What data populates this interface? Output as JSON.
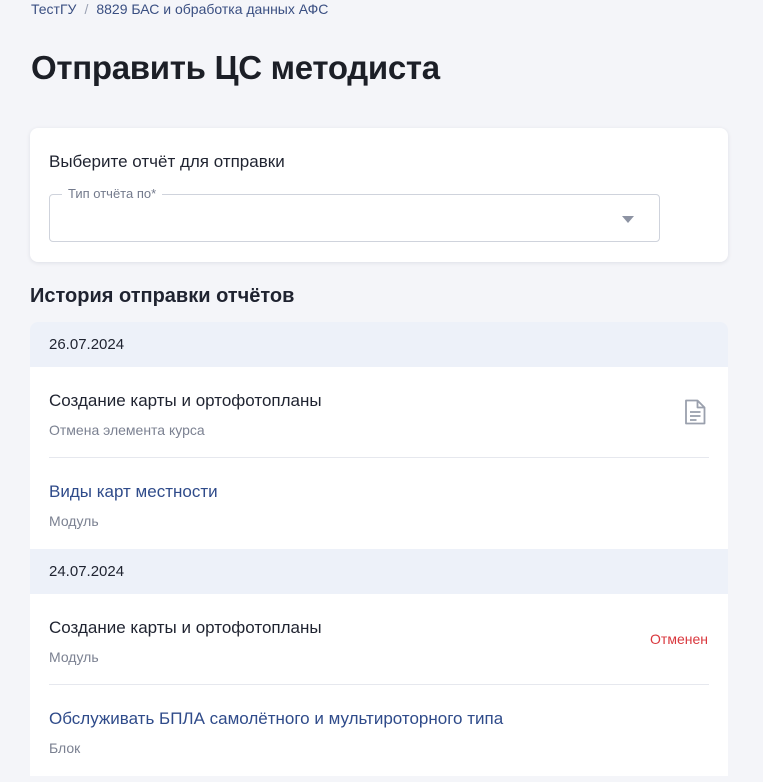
{
  "breadcrumb": {
    "items": [
      "ТестГУ",
      "8829 БАС и обработка данных АФС"
    ],
    "separator": "/"
  },
  "page_title": "Отправить ЦС методиста",
  "report_card": {
    "title": "Выберите отчёт для отправки",
    "select": {
      "label": "Тип отчёта по*",
      "value": ""
    }
  },
  "history": {
    "title": "История отправки отчётов",
    "groups": [
      {
        "date": "26.07.2024",
        "items": [
          {
            "title": "Создание карты и ортофотопланы",
            "subtitle": "Отмена элемента курса",
            "action": "document-icon"
          },
          {
            "title": "Виды карт местности",
            "subtitle": "Модуль"
          }
        ]
      },
      {
        "date": "24.07.2024",
        "items": [
          {
            "title": "Создание карты и ортофотопланы",
            "subtitle": "Модуль",
            "status": "Отменен"
          },
          {
            "title": "Обслуживать БПЛА самолётного и мультироторного типа",
            "subtitle": "Блок"
          }
        ]
      }
    ]
  },
  "colors": {
    "background": "#f4f5f9",
    "link": "#2f4b8a",
    "status_cancelled": "#d9373d",
    "date_row": "#edf1f9"
  }
}
